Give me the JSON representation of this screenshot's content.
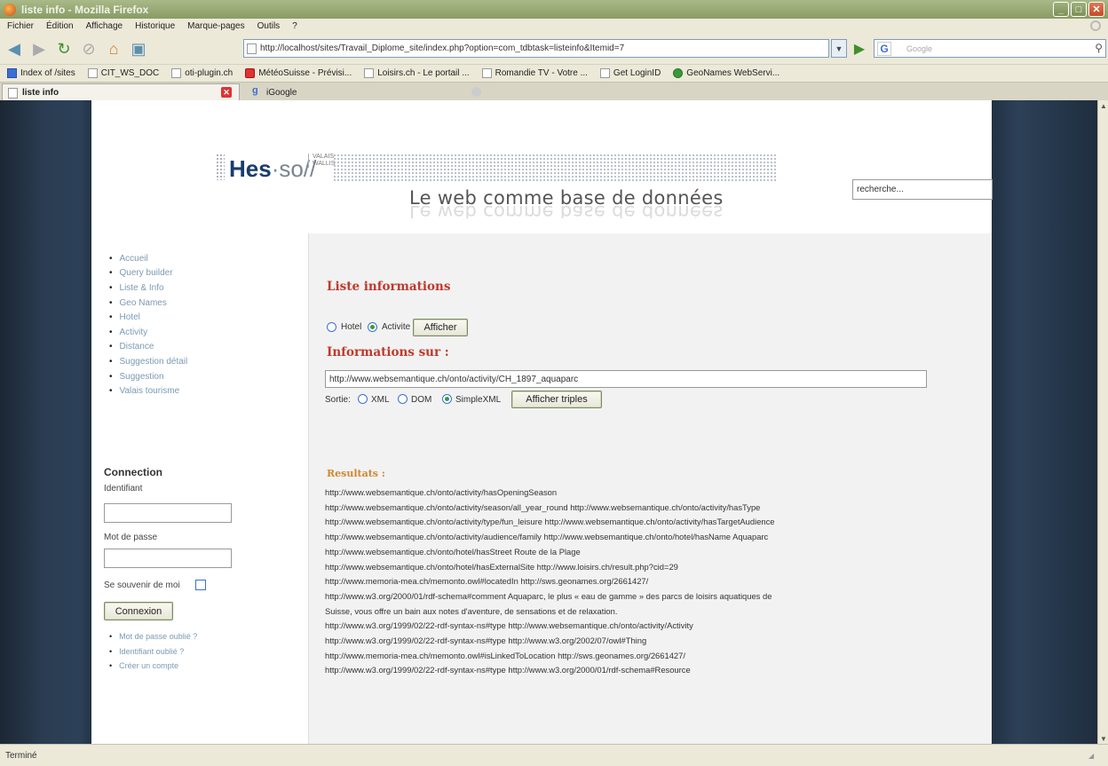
{
  "window": {
    "title": "liste info - Mozilla Firefox"
  },
  "menu": [
    "Fichier",
    "Édition",
    "Affichage",
    "Historique",
    "Marque-pages",
    "Outils",
    "?"
  ],
  "nav": {
    "url": "http://localhost/sites/Travail_Diplome_site/index.php?option=com_tdbtask=listeinfo&Itemid=7",
    "search_placeholder": "Google",
    "search_engine_glyph": "G"
  },
  "bookmarks": [
    "Index of /sites",
    "CIT_WS_DOC",
    "oti-plugin.ch",
    "MétéoSuisse - Prévisi...",
    "Loisirs.ch - Le portail ...",
    "Romandie TV - Votre ...",
    "Get LoginID",
    "GeoNames WebServi..."
  ],
  "tabs": [
    {
      "label": "liste info",
      "active": true
    },
    {
      "label": "iGoogle",
      "active": false
    }
  ],
  "site": {
    "logo_main": "Hes",
    "logo_so": "·so//",
    "logo_valais_line1": "VALAIS",
    "logo_valais_line2": "WALLIS",
    "title": "Le web comme base de données",
    "search_value": "recherche..."
  },
  "sidebar": {
    "items": [
      "Accueil",
      "Query builder",
      "Liste & Info",
      "Geo Names",
      "Hotel",
      "Activity",
      "Distance",
      "Suggestion détail",
      "Suggestion",
      "Valais tourisme"
    ],
    "connection_title": "Connection",
    "identifiant_label": "Identifiant",
    "password_label": "Mot de passe",
    "remember_label": "Se souvenir de moi",
    "login_button": "Connexion",
    "links": [
      "Mot de passe oublié ?",
      "Identifiant oublié ?",
      "Créer un compte"
    ]
  },
  "main": {
    "heading1": "Liste informations",
    "radio_hotel": "Hotel",
    "radio_activite": "Activite",
    "show_button": "Afficher",
    "heading2": "Informations sur :",
    "uri_value": "http://www.websemantique.ch/onto/activity/CH_1897_aquaparc",
    "output_label": "Sortie:",
    "opt_xml": "XML",
    "opt_dom": "DOM",
    "opt_simplexml": "SimpleXML",
    "show_triples_button": "Afficher triples",
    "results_title": "Resultats :",
    "results": [
      "http://www.websemantique.ch/onto/activity/hasOpeningSeason",
      "http://www.websemantique.ch/onto/activity/season/all_year_round http://www.websemantique.ch/onto/activity/hasType",
      "http://www.websemantique.ch/onto/activity/type/fun_leisure http://www.websemantique.ch/onto/activity/hasTargetAudience",
      "http://www.websemantique.ch/onto/activity/audience/family http://www.websemantique.ch/onto/hotel/hasName Aquaparc",
      "http://www.websemantique.ch/onto/hotel/hasStreet Route de la Plage",
      "http://www.websemantique.ch/onto/hotel/hasExternalSite http://www.loisirs.ch/result.php?cid=29",
      "http://www.memoria-mea.ch/memonto.owl#locatedIn http://sws.geonames.org/2661427/",
      "http://www.w3.org/2000/01/rdf-schema#comment Aquaparc, le plus « eau de gamme » des parcs de loisirs aquatiques de",
      "Suisse, vous offre un bain aux notes d'aventure, de sensations et de relaxation.",
      "http://www.w3.org/1999/02/22-rdf-syntax-ns#type http://www.websemantique.ch/onto/activity/Activity",
      "http://www.w3.org/1999/02/22-rdf-syntax-ns#type http://www.w3.org/2002/07/owl#Thing",
      "http://www.memoria-mea.ch/memonto.owl#isLinkedToLocation http://sws.geonames.org/2661427/",
      "http://www.w3.org/1999/02/22-rdf-syntax-ns#type http://www.w3.org/2000/01/rdf-schema#Resource"
    ]
  },
  "status": "Terminé"
}
